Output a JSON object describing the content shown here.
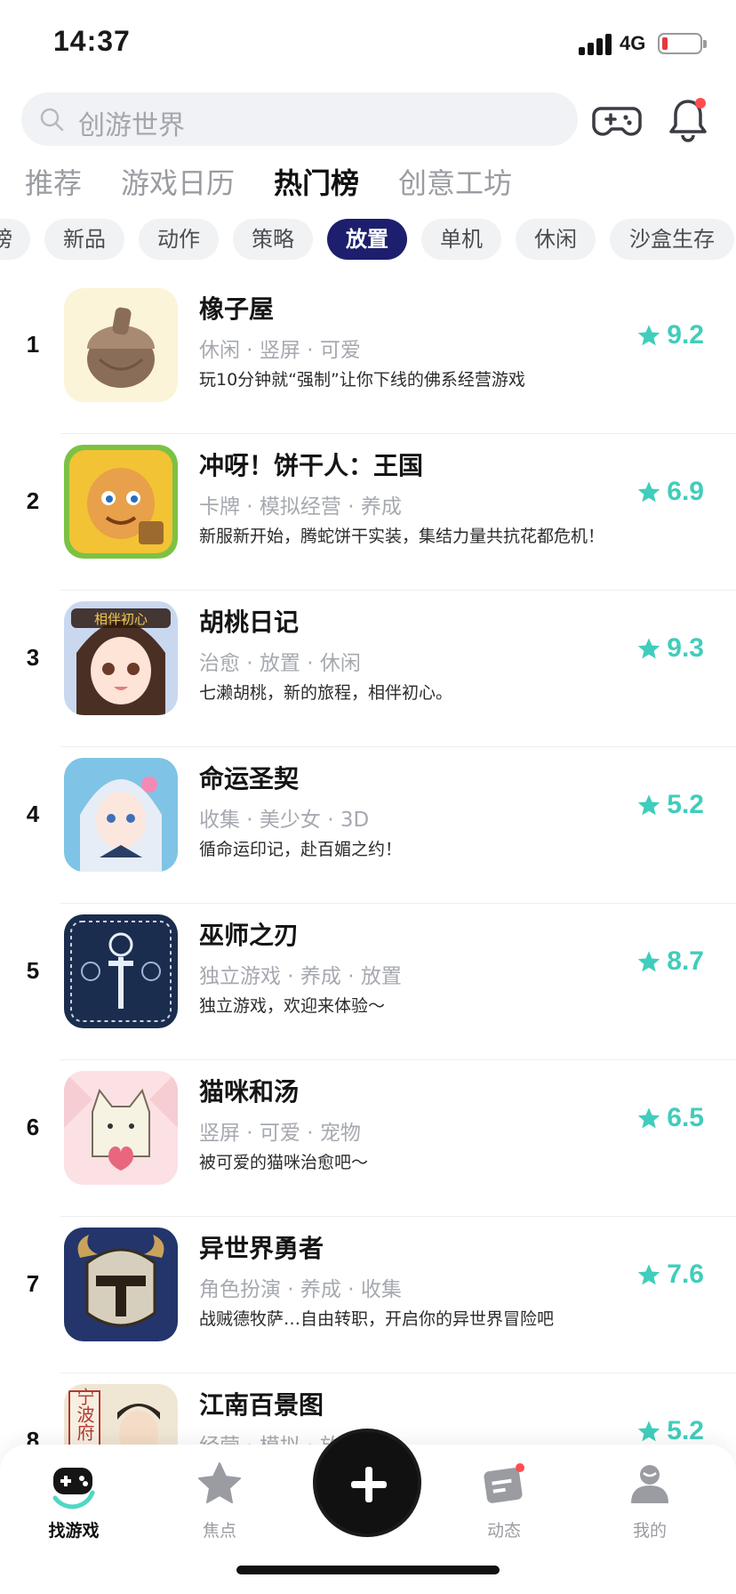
{
  "status_bar": {
    "time": "14:37",
    "network": "4G"
  },
  "search": {
    "placeholder": "创游世界"
  },
  "main_tabs": [
    {
      "label": "推荐"
    },
    {
      "label": "游戏日历"
    },
    {
      "label": "热门榜",
      "active": true
    },
    {
      "label": "创意工坊"
    }
  ],
  "categories": [
    {
      "label": "榜"
    },
    {
      "label": "新品"
    },
    {
      "label": "动作"
    },
    {
      "label": "策略"
    },
    {
      "label": "放置",
      "active": true
    },
    {
      "label": "单机"
    },
    {
      "label": "休闲"
    },
    {
      "label": "沙盒生存"
    }
  ],
  "games": [
    {
      "rank": "1",
      "title": "橡子屋",
      "tags": "休闲 · 竖屏 · 可爱",
      "desc": "玩10分钟就“强制”让你下线的佛系经营游戏",
      "score": "9.2"
    },
    {
      "rank": "2",
      "title": "冲呀！饼干人：王国",
      "tags": "卡牌 · 模拟经营 · 养成",
      "desc": "新服新开始，腾蛇饼干实装，集结力量共抗花都危机！",
      "score": "6.9"
    },
    {
      "rank": "3",
      "title": "胡桃日记",
      "tags": "治愈 · 放置 · 休闲",
      "desc": "七濑胡桃，新的旅程，相伴初心。",
      "score": "9.3",
      "icon_text": "相伴初心"
    },
    {
      "rank": "4",
      "title": "命运圣契",
      "tags": "收集 · 美少女 · 3D",
      "desc": "循命运印记，赴百媚之约！",
      "score": "5.2"
    },
    {
      "rank": "5",
      "title": "巫师之刃",
      "tags": "独立游戏 · 养成 · 放置",
      "desc": "独立游戏，欢迎来体验～",
      "score": "8.7"
    },
    {
      "rank": "6",
      "title": "猫咪和汤",
      "tags": "竖屏 · 可爱 · 宠物",
      "desc": "被可爱的猫咪治愈吧～",
      "score": "6.5"
    },
    {
      "rank": "7",
      "title": "异世界勇者",
      "tags": "角色扮演 · 养成 · 收集",
      "desc": "战贼德牧萨…自由转职，开启你的异世界冒险吧",
      "score": "7.6"
    },
    {
      "rank": "8",
      "title": "江南百景图",
      "tags": "经营 · 模拟 · 放",
      "desc": "",
      "score": "5.2",
      "icon_text": "宁波府"
    }
  ],
  "bottom_nav": [
    {
      "label": "找游戏",
      "icon": "gamepad-icon",
      "active": true
    },
    {
      "label": "焦点",
      "icon": "star-icon"
    },
    {
      "label": "",
      "icon": "plus-icon"
    },
    {
      "label": "动态",
      "icon": "feed-icon"
    },
    {
      "label": "我的",
      "icon": "profile-icon"
    }
  ],
  "colors": {
    "accent": "#40cdbb",
    "active_chip": "#1d1f6e",
    "tab_underline": "#4fd8c4",
    "badge_red": "#ff4d4f"
  }
}
